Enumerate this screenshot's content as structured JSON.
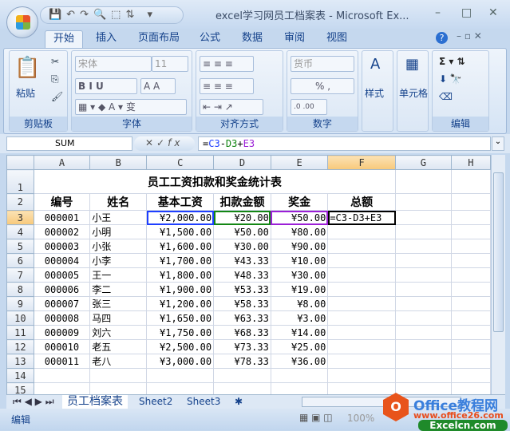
{
  "window": {
    "title": "excel学习网员工档案表 - Microsoft Ex..."
  },
  "tabs": [
    "开始",
    "插入",
    "页面布局",
    "公式",
    "数据",
    "审阅",
    "视图"
  ],
  "ribbon": {
    "clipboard": {
      "label": "剪贴板",
      "paste": "粘贴"
    },
    "font": {
      "label": "字体",
      "font_name": "宋体",
      "font_size": "11"
    },
    "alignment": {
      "label": "对齐方式"
    },
    "number": {
      "label": "数字",
      "format": "货币",
      "percent": "%",
      "comma": ","
    },
    "styles": {
      "label": "样式"
    },
    "cells": {
      "label": "单元格"
    },
    "editing": {
      "label": "编辑"
    }
  },
  "formula_bar": {
    "name_box": "SUM",
    "formula": "=C3-D3+E3",
    "formula_parts": [
      "=",
      "C3",
      "-",
      "D3",
      "+",
      "E3"
    ]
  },
  "colors": {
    "c3": "#1f3fff",
    "d3": "#138613",
    "e3": "#9b1fd6"
  },
  "columns": [
    "A",
    "B",
    "C",
    "D",
    "E",
    "F",
    "G",
    "H"
  ],
  "sheet": {
    "title": "员工工资扣款和奖金统计表",
    "headers": [
      "编号",
      "姓名",
      "基本工资",
      "扣款金额",
      "奖金",
      "总额"
    ],
    "rows": [
      [
        "000001",
        "小王",
        "¥2,000.00",
        "¥20.00",
        "¥50.00",
        "=C3-D3+E3"
      ],
      [
        "000002",
        "小明",
        "¥1,500.00",
        "¥50.00",
        "¥80.00",
        ""
      ],
      [
        "000003",
        "小张",
        "¥1,600.00",
        "¥30.00",
        "¥90.00",
        ""
      ],
      [
        "000004",
        "小李",
        "¥1,700.00",
        "¥43.33",
        "¥10.00",
        ""
      ],
      [
        "000005",
        "王一",
        "¥1,800.00",
        "¥48.33",
        "¥30.00",
        ""
      ],
      [
        "000006",
        "李二",
        "¥1,900.00",
        "¥53.33",
        "¥19.00",
        ""
      ],
      [
        "000007",
        "张三",
        "¥1,200.00",
        "¥58.33",
        "¥8.00",
        ""
      ],
      [
        "000008",
        "马四",
        "¥1,650.00",
        "¥63.33",
        "¥3.00",
        ""
      ],
      [
        "000009",
        "刘六",
        "¥1,750.00",
        "¥68.33",
        "¥14.00",
        ""
      ],
      [
        "000010",
        "老五",
        "¥2,500.00",
        "¥73.33",
        "¥25.00",
        ""
      ],
      [
        "000011",
        "老八",
        "¥3,000.00",
        "¥78.33",
        "¥36.00",
        ""
      ]
    ]
  },
  "sheet_tabs": [
    "员工档案表",
    "Sheet2",
    "Sheet3"
  ],
  "status": {
    "mode": "编辑",
    "zoom": "100%"
  },
  "watermark": {
    "line1": "Office教程网",
    "line2": "www.office26.com",
    "line3": "Excelcn.com"
  }
}
